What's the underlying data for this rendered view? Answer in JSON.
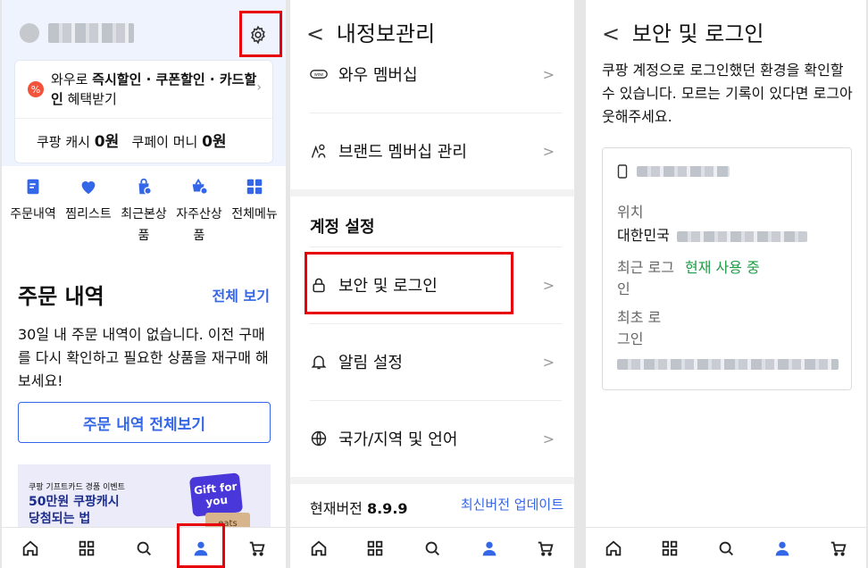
{
  "panel1": {
    "promo_prefix": "와우로 ",
    "promo_bold": "즉시할인 · 쿠폰할인 · 카드할인",
    "promo_suffix": " 혜택받기",
    "promo_icon": "%",
    "promo_chevron": "›",
    "cash_label": "쿠팡 캐시 ",
    "cash_value": "0원",
    "pay_label": "쿠페이 머니 ",
    "pay_value": "0원",
    "quick_menu": [
      {
        "label": "주문내역",
        "icon": "receipt-icon"
      },
      {
        "label": "찜리스트",
        "icon": "heart-icon"
      },
      {
        "label": "최근본상품",
        "icon": "recent-bag-icon"
      },
      {
        "label": "자주산상품",
        "icon": "repeat-bag-icon"
      },
      {
        "label": "전체메뉴",
        "icon": "grid-icon"
      }
    ],
    "orders_heading": "주문 내역",
    "see_all": "전체 보기",
    "empty_text": "30일 내 주문 내역이 없습니다. 이전 구매를 다시 확인하고 필요한 상품을 재구매 해보세요!",
    "all_orders_button": "주문 내역 전체보기",
    "banner": {
      "line1": "쿠팡 기프트카드 경품 이벤트",
      "line2": "50만원 쿠팡캐시",
      "line3": "당첨되는 법",
      "card_text": "Gift for you",
      "eats_text": "eats"
    }
  },
  "panel2": {
    "back": "<",
    "title": "내정보관리",
    "items_top": [
      {
        "label": "와우 멤버십",
        "icon": "wow-badge-icon"
      },
      {
        "label": "브랜드 멤버십 관리",
        "icon": "brand-membership-icon"
      }
    ],
    "section_title": "계정 설정",
    "items_account": [
      {
        "label": "보안 및 로그인",
        "icon": "lock-icon"
      },
      {
        "label": "알림 설정",
        "icon": "bell-icon"
      },
      {
        "label": "국가/지역 및 언어",
        "icon": "globe-icon"
      }
    ],
    "chevron": ">",
    "wow_badge": "wow",
    "version_label": "현재버전 ",
    "version_value": "8.9.9",
    "update_link": "최신버전 업데이트"
  },
  "panel3": {
    "back": "<",
    "title": "보안 및 로그인",
    "description": "쿠팡 계정으로 로그인했던 환경을 확인할 수 있습니다. 모르는 기록이 있다면 로그아웃해주세요.",
    "location_label": "위치",
    "location_value": "대한민국",
    "recent_login_label": "최근 로그인",
    "recent_login_value": "현재 사용 중",
    "first_login_label": "최초 로그인"
  },
  "bottom_nav": [
    "home-icon",
    "category-icon",
    "search-icon",
    "my-coupang-icon",
    "cart-icon"
  ],
  "colors": {
    "accent": "#3466e8",
    "highlight": "#e8000b",
    "green": "#1e9b45"
  }
}
